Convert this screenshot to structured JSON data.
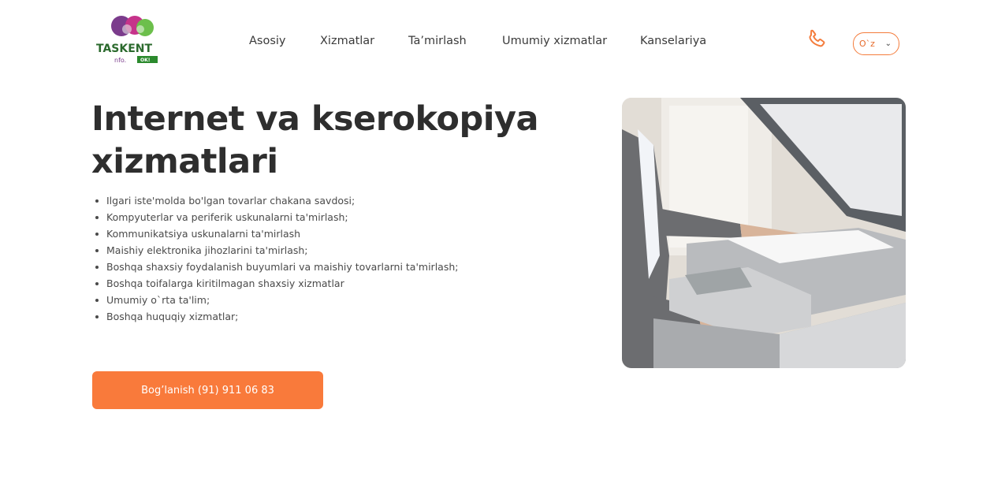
{
  "header": {
    "logo_text_top": "TASKENT",
    "logo_text_bottom": "nfo.",
    "logo_badge": "OK!",
    "nav": [
      {
        "label": "Asosiy"
      },
      {
        "label": "Xizmatlar"
      },
      {
        "label": "Ta’mirlash"
      },
      {
        "label": "Umumiy xizmatlar"
      },
      {
        "label": "Kanselariya"
      }
    ],
    "phone_icon": "phone-icon",
    "language": {
      "selected": "O`z",
      "icon": "chevron-down-icon"
    }
  },
  "hero": {
    "title_line1": "Internet va kserokopiya",
    "title_line2": "xizmatlari",
    "services": [
      "Ilgari iste'molda bo'lgan tovarlar chakana savdosi;",
      "Kompyuterlar va periferik uskunalarni ta'mirlash;",
      "Kommunikatsiya uskunalarni ta'mirlash",
      "Maishiy elektronika jihozlarini ta'mirlash;",
      "Boshqa shaxsiy foydalanish buyumlari va maishiy tovarlarni ta'mirlash;",
      "Boshqa toifalarga kiritilmagan shaxsiy xizmatlar",
      "Umumiy o`rta ta'lim;",
      "Boshqa huquqiy xizmatlar;"
    ],
    "cta_label": "Bog’lanish (91) 911 06 83"
  },
  "colors": {
    "accent": "#f97a3b",
    "title": "#2e2e2e",
    "text": "#4a4a4a"
  }
}
